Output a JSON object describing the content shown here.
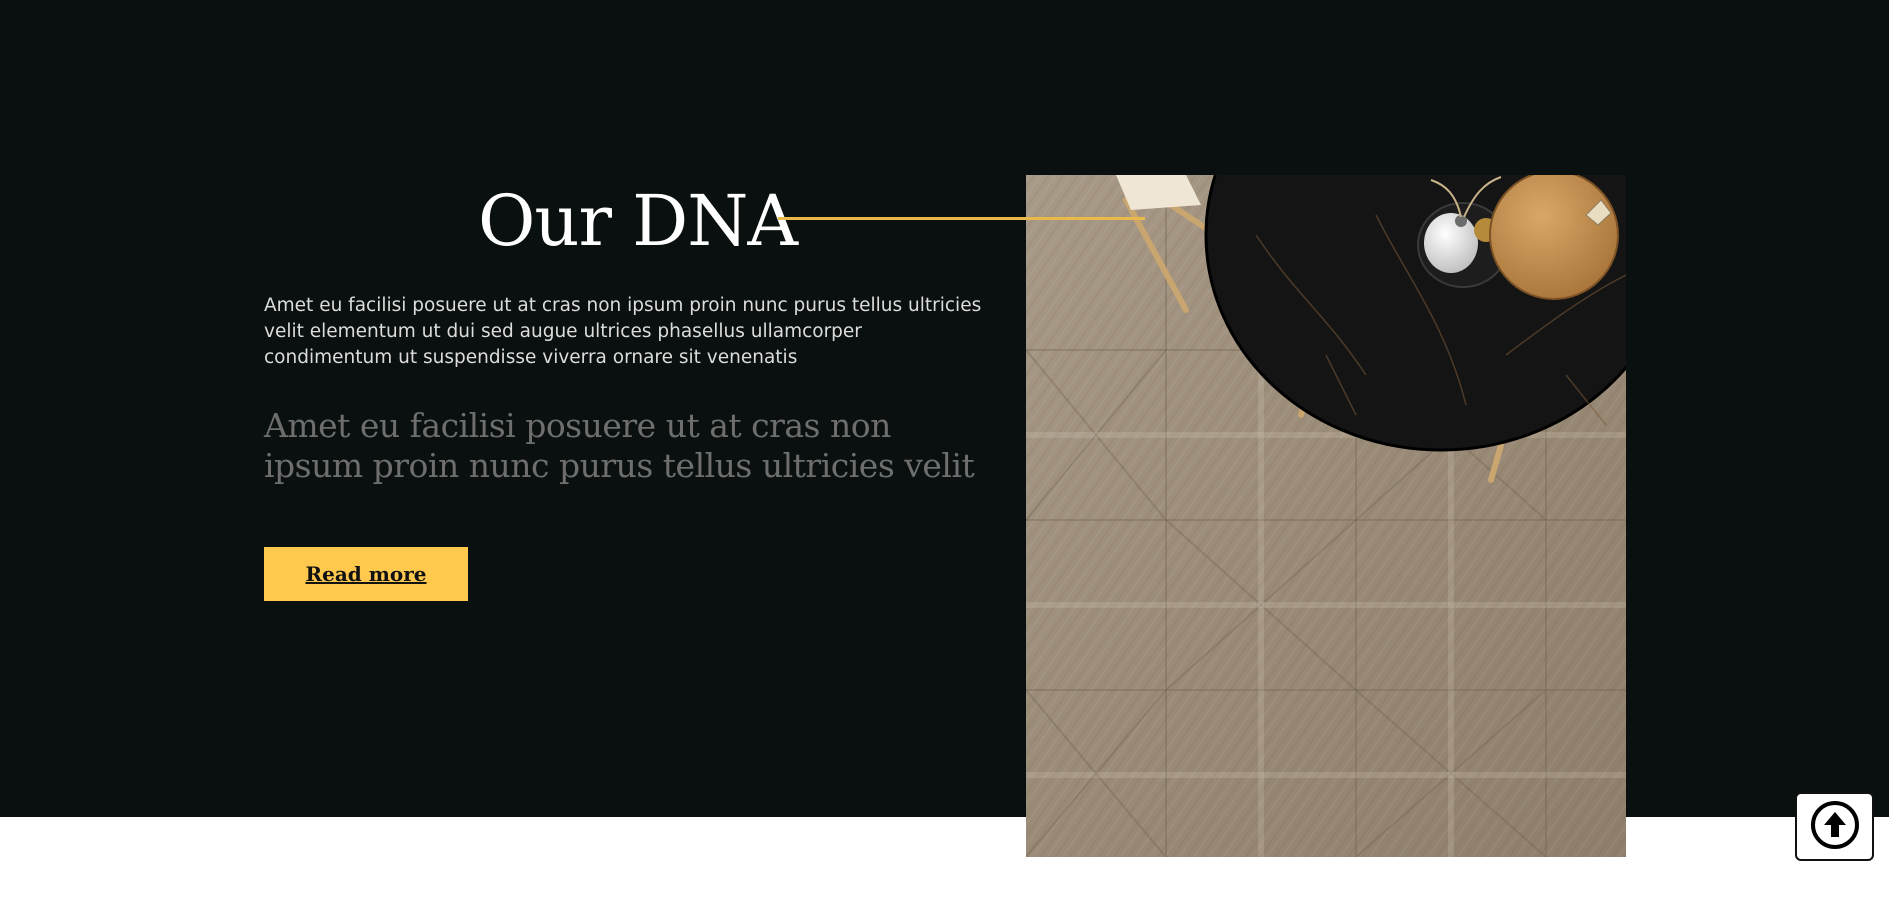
{
  "section": {
    "title": "Our DNA",
    "body": "Amet eu facilisi posuere ut at cras non ipsum proin nunc purus tellus ultricies velit elementum ut dui sed augue ultrices phasellus ullamcorper condimentum ut suspendisse viverra ornare sit venenatis",
    "quote": "Amet eu facilisi posuere ut at cras non ipsum proin nunc purus tellus ultricies velit",
    "button_label": "Read more"
  },
  "colors": {
    "background": "#0a0f0f",
    "accent": "#ffc94d",
    "line": "#e9b949",
    "title": "#ffffff",
    "body_text": "#dcdcdc",
    "quote_text": "#6e6e6e"
  },
  "icons": {
    "scroll_top": "arrow-up-circle-icon"
  }
}
